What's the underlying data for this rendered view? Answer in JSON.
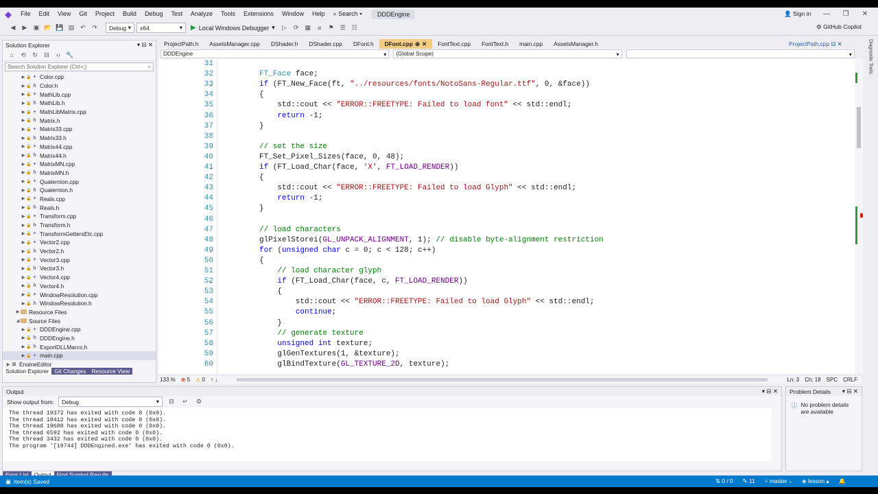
{
  "menu": {
    "items": [
      "File",
      "Edit",
      "View",
      "Git",
      "Project",
      "Build",
      "Debug",
      "Test",
      "Analyze",
      "Tools",
      "Extensions",
      "Window",
      "Help"
    ],
    "search_label": "Search",
    "solution_title": "DDDEngine",
    "sign_in": "Sign in",
    "copilot": "GitHub Copilot"
  },
  "toolbar": {
    "config": "Debug",
    "platform": "x64",
    "run_label": "Local Windows Debugger"
  },
  "solution_explorer": {
    "title": "Solution Explorer",
    "search_placeholder": "Search Solution Explorer (Ctrl+;)",
    "files": [
      {
        "name": "Color.cpp",
        "type": "cpp"
      },
      {
        "name": "Color.h",
        "type": "h"
      },
      {
        "name": "MathLib.cpp",
        "type": "cpp"
      },
      {
        "name": "MathLib.h",
        "type": "h"
      },
      {
        "name": "MathLibMatrix.cpp",
        "type": "cpp"
      },
      {
        "name": "Matrix.h",
        "type": "h"
      },
      {
        "name": "Matrix33.cpp",
        "type": "cpp"
      },
      {
        "name": "Matrix33.h",
        "type": "h"
      },
      {
        "name": "Matrix44.cpp",
        "type": "cpp"
      },
      {
        "name": "Matrix44.h",
        "type": "h"
      },
      {
        "name": "MatrixMN.cpp",
        "type": "cpp"
      },
      {
        "name": "MatrixMN.h",
        "type": "h"
      },
      {
        "name": "Quaternion.cpp",
        "type": "cpp"
      },
      {
        "name": "Quaternion.h",
        "type": "h"
      },
      {
        "name": "Reals.cpp",
        "type": "cpp"
      },
      {
        "name": "Reals.h",
        "type": "h"
      },
      {
        "name": "Transform.cpp",
        "type": "cpp"
      },
      {
        "name": "Transform.h",
        "type": "h"
      },
      {
        "name": "TransformGettersEtc.cpp",
        "type": "cpp"
      },
      {
        "name": "Vector2.cpp",
        "type": "cpp"
      },
      {
        "name": "Vector2.h",
        "type": "h"
      },
      {
        "name": "Vector3.cpp",
        "type": "cpp"
      },
      {
        "name": "Vector3.h",
        "type": "h"
      },
      {
        "name": "Vector4.cpp",
        "type": "cpp"
      },
      {
        "name": "Vector4.h",
        "type": "h"
      },
      {
        "name": "WindowResolution.cpp",
        "type": "cpp"
      },
      {
        "name": "WindowResolution.h",
        "type": "h"
      }
    ],
    "resource_files": "Resource Files",
    "source_files": "Source Files",
    "source_items": [
      {
        "name": "DDDEngine.cpp",
        "type": "cpp"
      },
      {
        "name": "DDDEngine.h",
        "type": "h"
      },
      {
        "name": "ExportDLLMarco.h",
        "type": "h"
      },
      {
        "name": "main.cpp",
        "type": "cpp"
      }
    ],
    "engine_editor": "EngineEditor",
    "tabs": [
      "Solution Explorer",
      "Git Changes",
      "Resource View"
    ]
  },
  "editor": {
    "tabs": [
      "ProjectPath.h",
      "AssetsManager.cpp",
      "DShader.h",
      "DShader.cpp",
      "DFont.h",
      "DFont.cpp",
      "FontText.cpp",
      "FontText.h",
      "main.cpp",
      "AssetsManager.h"
    ],
    "active_tab": "DFont.cpp",
    "pinned_tab": "ProjectPath.cpp",
    "project_nav": "DDDEngine",
    "scope_nav": "(Global Scope)",
    "zoom": "133 %",
    "errors": "5",
    "warnings": "0",
    "position": "Ln: 3",
    "column": "Ch: 18",
    "spacing": "SPC",
    "line_ending": "CRLF",
    "lines": [
      {
        "n": "31",
        "fold": "",
        "text": ""
      },
      {
        "n": "32",
        "fold": "",
        "text": "FT_Face face;"
      },
      {
        "n": "33",
        "fold": "v",
        "text": "if (FT_New_Face(ft, \"../resources/fonts/NotoSans-Regular.ttf\", 0, &face))"
      },
      {
        "n": "34",
        "fold": "",
        "text": "{"
      },
      {
        "n": "35",
        "fold": "",
        "text": "    std::cout << \"ERROR::FREETYPE: Failed to load font\" << std::endl;"
      },
      {
        "n": "36",
        "fold": "",
        "text": "    return -1;"
      },
      {
        "n": "37",
        "fold": "",
        "text": "}"
      },
      {
        "n": "38",
        "fold": "",
        "text": ""
      },
      {
        "n": "39",
        "fold": "",
        "text": "// set the size"
      },
      {
        "n": "40",
        "fold": "",
        "text": "FT_Set_Pixel_Sizes(face, 0, 48);"
      },
      {
        "n": "41",
        "fold": "v",
        "text": "if (FT_Load_Char(face, 'X', FT_LOAD_RENDER))"
      },
      {
        "n": "42",
        "fold": "",
        "text": "{"
      },
      {
        "n": "43",
        "fold": "",
        "text": "    std::cout << \"ERROR::FREETYPE: Failed to load Glyph\" << std::endl;"
      },
      {
        "n": "44",
        "fold": "",
        "text": "    return -1;"
      },
      {
        "n": "45",
        "fold": "",
        "text": "}"
      },
      {
        "n": "46",
        "fold": "",
        "text": ""
      },
      {
        "n": "47",
        "fold": "",
        "text": "// load characters"
      },
      {
        "n": "48",
        "fold": "",
        "text": "glPixelStorei(GL_UNPACK_ALIGNMENT, 1); // disable byte-alignment restriction"
      },
      {
        "n": "49",
        "fold": "v",
        "text": "for (unsigned char c = 0; c < 128; c++)"
      },
      {
        "n": "50",
        "fold": "",
        "text": "{"
      },
      {
        "n": "51",
        "fold": "",
        "text": "    // load character glyph"
      },
      {
        "n": "52",
        "fold": "v",
        "text": "    if (FT_Load_Char(face, c, FT_LOAD_RENDER))"
      },
      {
        "n": "53",
        "fold": "",
        "text": "    {"
      },
      {
        "n": "54",
        "fold": "",
        "text": "        std::cout << \"ERROR::FREETYPE: Failed to load Glyph\" << std::endl;"
      },
      {
        "n": "55",
        "fold": "",
        "text": "        continue;"
      },
      {
        "n": "56",
        "fold": "",
        "text": "    }"
      },
      {
        "n": "57",
        "fold": "",
        "text": "    // generate texture"
      },
      {
        "n": "58",
        "fold": "",
        "text": "    unsigned int texture;"
      },
      {
        "n": "59",
        "fold": "",
        "text": "    glGenTextures(1, &texture);"
      },
      {
        "n": "60",
        "fold": "",
        "text": "    glBindTexture(GL_TEXTURE_2D, texture);"
      }
    ]
  },
  "output": {
    "title": "Output",
    "show_from_label": "Show output from:",
    "source": "Debug",
    "text": "The thread 19372 has exited with code 0 (0x0).\nThe thread 18412 has exited with code 0 (0x0).\nThe thread 19688 has exited with code 0 (0x0).\nThe thread 6592 has exited with code 0 (0x0).\nThe thread 3432 has exited with code 0 (0x0).\nThe program '[19744] DDDEngined.exe' has exited with code 0 (0x0).",
    "tabs": [
      "Error List",
      "Output",
      "Find Symbol Results"
    ]
  },
  "problems": {
    "title": "Problem Details",
    "message": "No problem details are available"
  },
  "diagnostic_tools": "Diagnostic Tools",
  "status": {
    "left": "Item(s) Saved",
    "counts": "0 / 0",
    "edits": "11",
    "branch": "master",
    "repo": "lesson"
  },
  "colors": {
    "accent": "#007acc",
    "active_tab": "#f5cc84",
    "keyword": "#0000ff",
    "string": "#a31515",
    "comment": "#008000",
    "macro": "#6f008a",
    "type": "#2b91af"
  }
}
